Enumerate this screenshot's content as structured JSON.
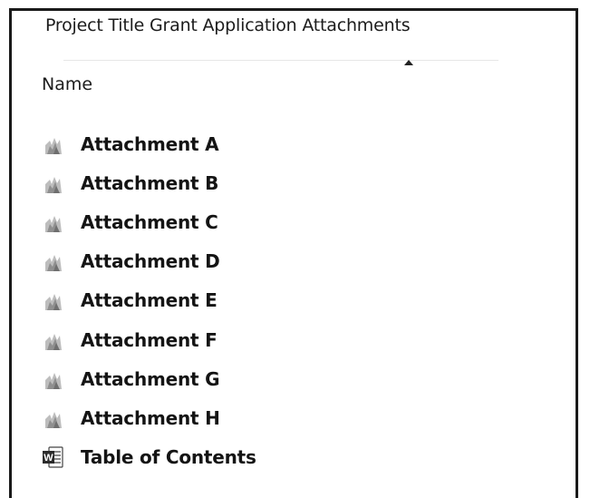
{
  "window": {
    "title": "Project Title Grant Application Attachments"
  },
  "columns": {
    "name": "Name"
  },
  "files": [
    {
      "name": "Attachment A",
      "icon": "pdf-file-icon"
    },
    {
      "name": "Attachment B",
      "icon": "pdf-file-icon"
    },
    {
      "name": "Attachment C",
      "icon": "pdf-file-icon"
    },
    {
      "name": "Attachment D",
      "icon": "pdf-file-icon"
    },
    {
      "name": "Attachment E",
      "icon": "pdf-file-icon"
    },
    {
      "name": "Attachment F",
      "icon": "pdf-file-icon"
    },
    {
      "name": "Attachment G",
      "icon": "pdf-file-icon"
    },
    {
      "name": "Attachment H",
      "icon": "pdf-file-icon"
    },
    {
      "name": "Table of Contents",
      "icon": "word-document-icon"
    }
  ],
  "colors": {
    "word_blue": "#2b579a",
    "pdf_gray": "#9a9a9a"
  }
}
